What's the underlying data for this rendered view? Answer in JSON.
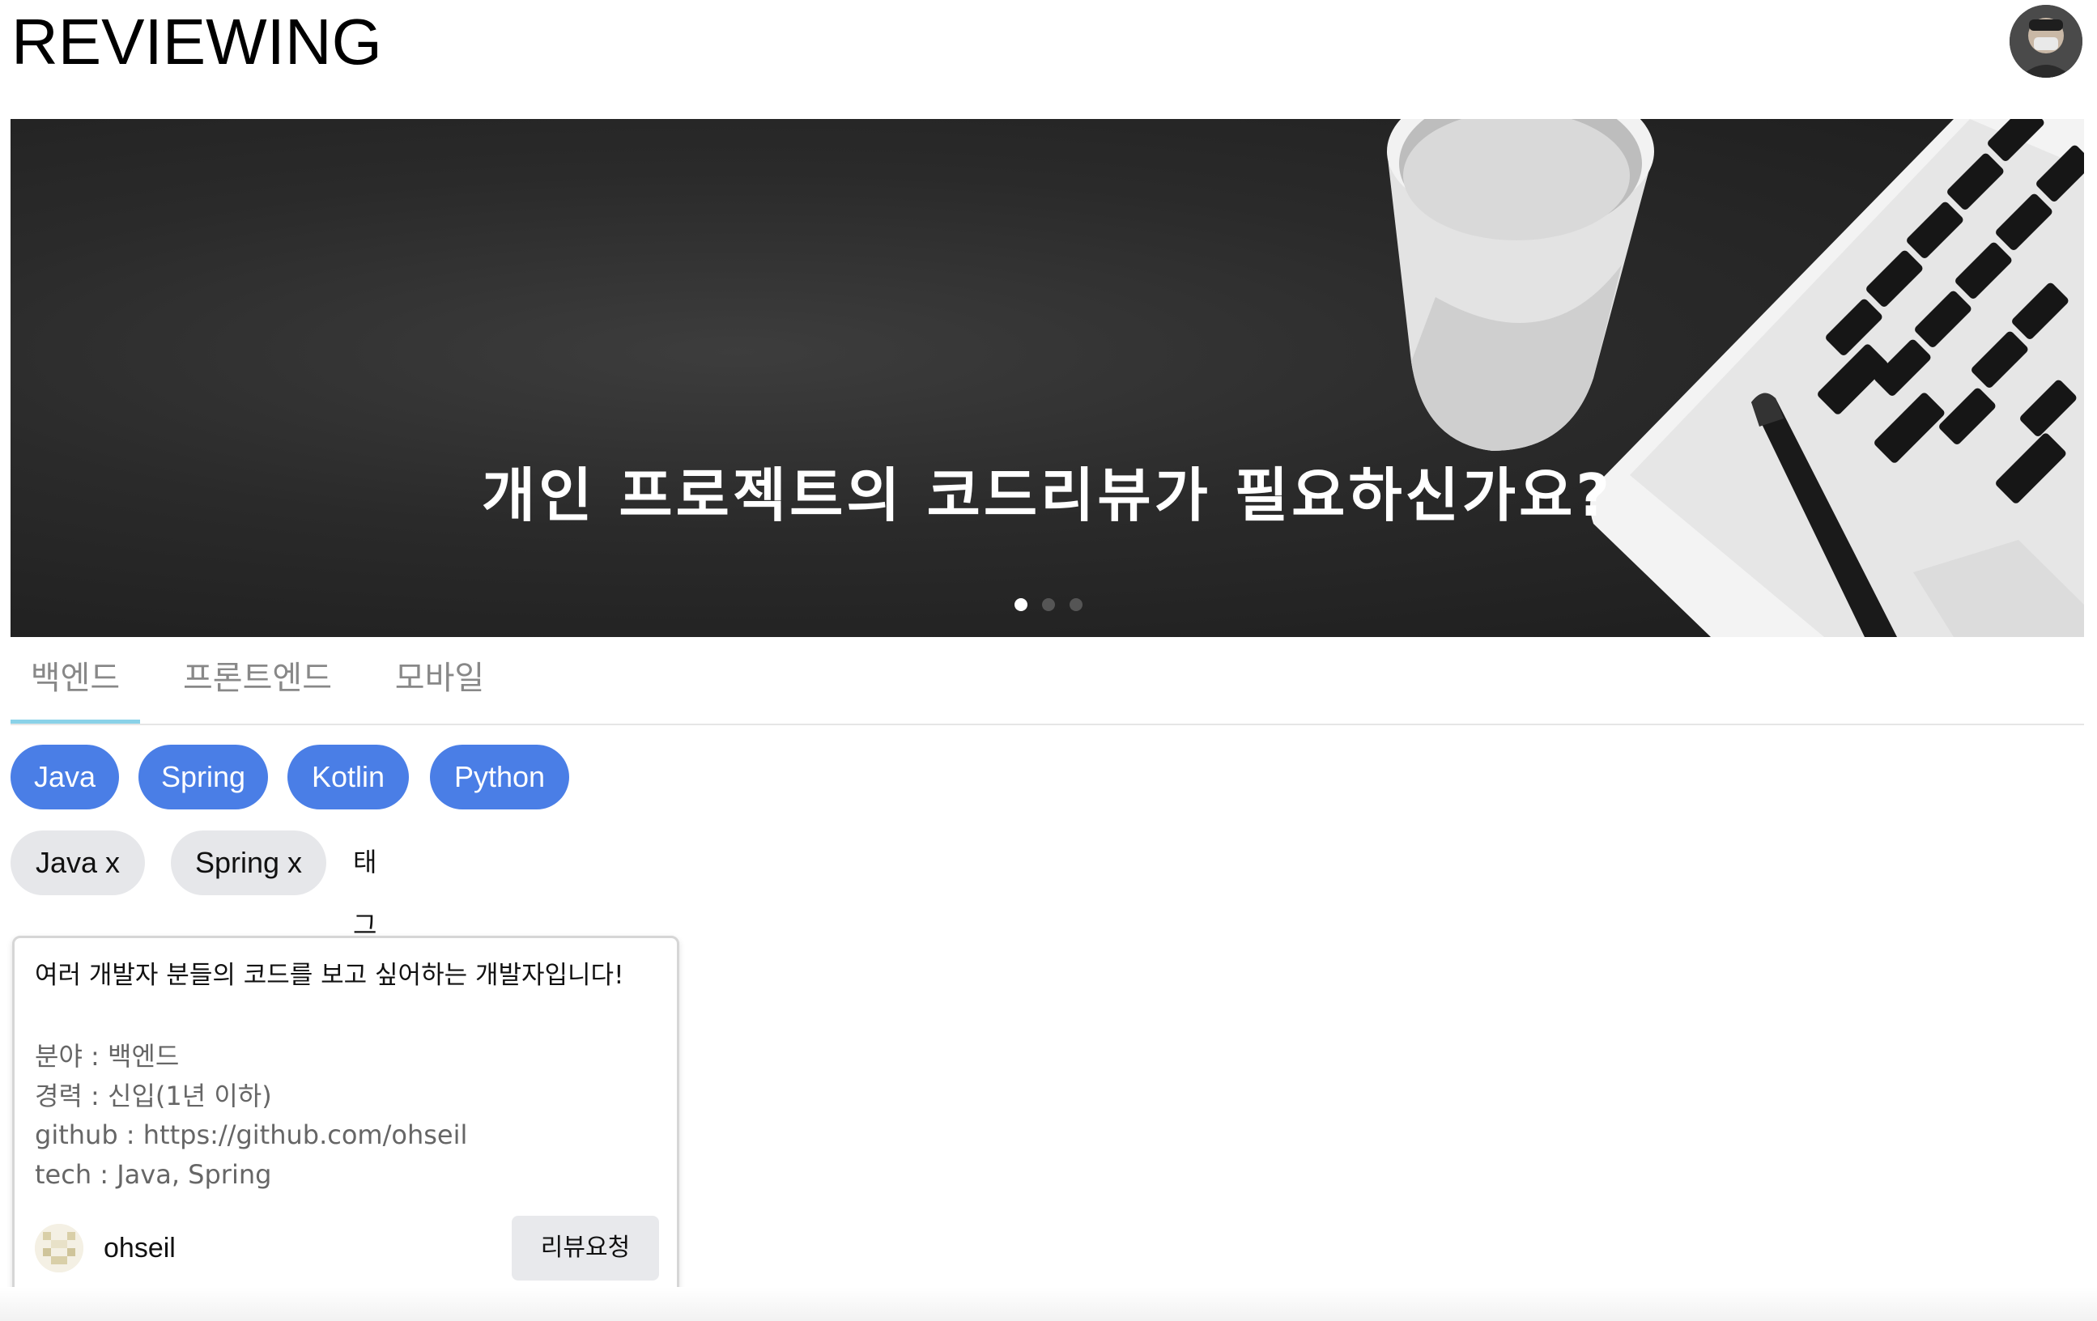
{
  "header": {
    "logo": "REVIEWING",
    "profile_icon": "user-avatar"
  },
  "hero": {
    "title": "개인 프로젝트의 코드리뷰가 필요하신가요?",
    "slide_count": 3,
    "active_slide": 1
  },
  "tabs": [
    {
      "label": "백엔드",
      "active": true
    },
    {
      "label": "프론트엔드",
      "active": false
    },
    {
      "label": "모바일",
      "active": false
    }
  ],
  "tag_chips": [
    "Java",
    "Spring",
    "Kotlin",
    "Python"
  ],
  "selected_tags": [
    "Java  x",
    "Spring  x"
  ],
  "reset_label": "태그 초기화",
  "cards": [
    {
      "title": "여러 개발자 분들의 코드를 보고 싶어하는 개발자입니다!",
      "lines": [
        "분야 : 백엔드",
        "경력 : 신입(1년 이하)",
        "github : https://github.com/ohseil",
        "tech : Java, Spring"
      ],
      "username": "ohseil",
      "button_label": "리뷰요청"
    }
  ],
  "colors": {
    "chip_blue": "#4a7ee6",
    "tab_underline": "#8ad2e8",
    "selected_chip_bg": "#e6e7ea"
  }
}
